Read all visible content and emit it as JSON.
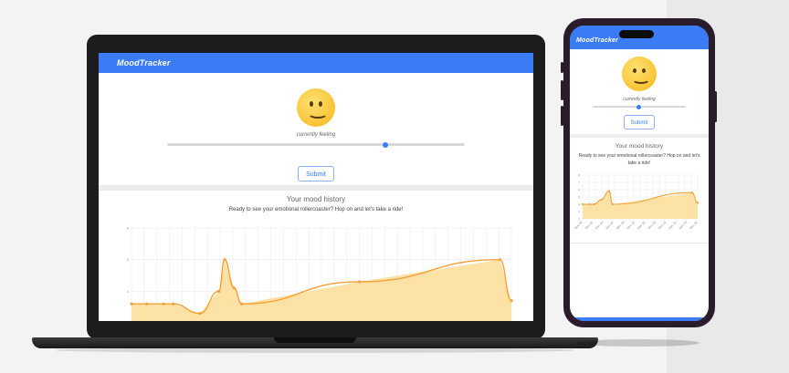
{
  "app": {
    "brand": "MoodTracker",
    "caption": "currently feeling",
    "submit_label": "Submit",
    "history_title": "Your mood history",
    "history_subtitle": "Ready to see your emotional rollercoaster? Hop on and let's take a ride!",
    "mood_emoji": "slightly-smiling-face",
    "mood_level": 0.62
  },
  "colors": {
    "accent": "#3a7cf5",
    "chart_line": "#f5a13a",
    "chart_fill": "#fde2a6"
  },
  "chart_data": {
    "type": "area",
    "yticks": [
      "2",
      "4",
      "6",
      "8"
    ],
    "ylim": [
      2,
      8
    ],
    "x": [
      0,
      0.04,
      0.085,
      0.11,
      0.18,
      0.23,
      0.245,
      0.27,
      0.29,
      0.6,
      0.97,
      1.0
    ],
    "values": [
      3.2,
      3.2,
      3.2,
      3.2,
      2.6,
      4.0,
      6.0,
      4.2,
      3.2,
      4.6,
      6.0,
      3.4
    ],
    "grid": true
  },
  "phone_chart_data": {
    "type": "area",
    "yticks": [
      "2",
      "3",
      "4",
      "5",
      "6",
      "7",
      "8"
    ],
    "x_labels": [
      "Nov 28",
      "Dec 01",
      "Dec 04",
      "Dec 07",
      "Dec 10",
      "Dec 13",
      "Dec 16",
      "Dec 19",
      "Dec 22",
      "Dec 25",
      "Dec 28",
      "Dec 31"
    ],
    "ylim": [
      2,
      8
    ],
    "x": [
      0,
      0.06,
      0.1,
      0.16,
      0.23,
      0.26,
      0.95,
      1.0
    ],
    "values": [
      4.0,
      4.0,
      4.0,
      4.6,
      5.8,
      4.0,
      5.6,
      4.2
    ],
    "grid": true
  }
}
